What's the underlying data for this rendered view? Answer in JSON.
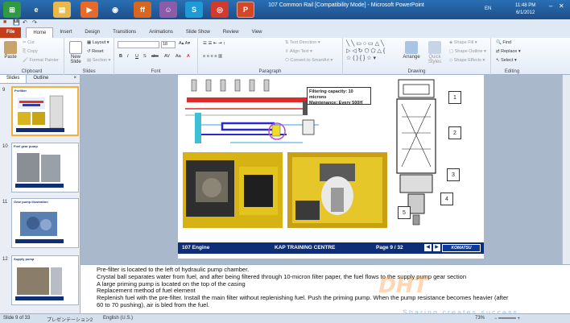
{
  "window": {
    "title": "107 Common Rail [Compatibility Mode] - Microsoft PowerPoint",
    "language": "EN",
    "clock_time": "11:48 PM",
    "clock_date": "6/1/2012",
    "taskbar_icons": [
      "windows-start-icon",
      "ie-icon",
      "explorer-icon",
      "media-player-icon",
      "camera-icon",
      "firefox-icon",
      "messenger-icon",
      "skype-icon",
      "chrome-icon",
      "powerpoint-icon"
    ]
  },
  "tabs": [
    "File",
    "Home",
    "Insert",
    "Design",
    "Transitions",
    "Animations",
    "Slide Show",
    "Review",
    "View"
  ],
  "ribbon": {
    "clipboard": {
      "label": "Clipboard",
      "paste": "Paste",
      "cut": "Cut",
      "copy": "Copy",
      "format_painter": "Format Painter"
    },
    "slides": {
      "label": "Slides",
      "new_slide": "New Slide",
      "layout": "Layout",
      "reset": "Reset",
      "section": "Section"
    },
    "font": {
      "label": "Font",
      "font_size": "18"
    },
    "paragraph": {
      "label": "Paragraph",
      "text_direction": "Text Direction",
      "align_text": "Align Text",
      "convert_smartart": "Convert to SmartArt"
    },
    "drawing": {
      "label": "Drawing",
      "arrange": "Arrange",
      "quick_styles": "Quick Styles",
      "shape_fill": "Shape Fill",
      "shape_outline": "Shape Outline",
      "shape_effects": "Shape Effects"
    },
    "editing": {
      "label": "Editing",
      "find": "Find",
      "replace": "Replace",
      "select": "Select"
    }
  },
  "left_panel": {
    "tabs": [
      "Slides",
      "Outline"
    ],
    "close": "×",
    "thumbnails": [
      {
        "num": "9",
        "title": "Prefilter",
        "selected": true
      },
      {
        "num": "10",
        "title": "Fuel gear pump",
        "selected": false
      },
      {
        "num": "11",
        "title": "Gear pump illustration",
        "selected": false
      },
      {
        "num": "12",
        "title": "Supply pump",
        "selected": false
      }
    ]
  },
  "slide": {
    "filter_line1": "Filtering  capacity: 10 microns",
    "filter_line2": "Maintenance: Every 500H",
    "footer_left": "107 Engine",
    "footer_center": "KAP TRAINING  CENTRE",
    "footer_page": "Page 9 / 32",
    "footer_logo": "KOMATSU",
    "callouts": [
      "1",
      "2",
      "3",
      "4",
      "5"
    ]
  },
  "notes": [
    "Pre-filter is located to the left of hydraulic pump chamber.",
    "Crystal ball separates water from fuel, and after being filtered through 10-micron filter paper, the fuel flows to the supply pump gear section",
    "A large priming pump is located on the top of the casing",
    "Replacement method of fuel element",
    "Replenish fuel with the pre-filter. Install the main filter without replenishing fuel. Push the priming pump. When the pump resistance becomes heavier (after",
    "60 to 70 pushing), air is bled from the fuel."
  ],
  "watermark": {
    "main": "DHT",
    "sub": "Sharing creates success"
  },
  "status": {
    "slide": "Slide 9 of 33",
    "theme": "プレゼンテーション2",
    "language": "English (U.S.)",
    "zoom": "73%"
  },
  "colors": {
    "file_tab": "#c43e1c",
    "footer_bg": "#0e2e77",
    "thumb_selected": "#f3b13c"
  }
}
